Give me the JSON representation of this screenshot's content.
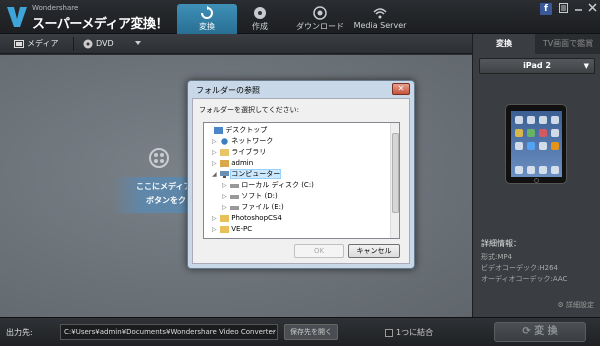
{
  "app": {
    "brand_small": "Wondershare",
    "brand_title": "スーパーメディア変換！",
    "accent_color": "#3a8fbb"
  },
  "nav": {
    "tabs": [
      {
        "label": "変換",
        "icon": "convert-icon",
        "active": true
      },
      {
        "label": "作成",
        "icon": "disc-icon",
        "active": false
      },
      {
        "label": "ダウンロード",
        "icon": "download-icon",
        "active": false
      },
      {
        "label": "Media Server",
        "icon": "wifi-icon",
        "active": false
      }
    ]
  },
  "window_controls": {
    "facebook": "f"
  },
  "toolbar": {
    "media_label": "メディア",
    "dvd_label": "DVD"
  },
  "main": {
    "drop_line1": "ここにメディア",
    "drop_line2": "ボタンをク"
  },
  "right_panel": {
    "tab_convert": "変換",
    "tab_tv": "TV画面で鑑賞",
    "device": "iPad 2",
    "details_title": "詳細情報：",
    "details": [
      "形式:MP4",
      "ビデオコーデック:H264",
      "オーディオコーデック:AAC"
    ],
    "advanced_label": "詳細設定"
  },
  "bottom": {
    "output_label": "出力先:",
    "output_path": "C:¥Users¥admin¥Documents¥Wondershare Video Converter Ultimate¥Or",
    "path_more": "···",
    "browse_label": "保存先を開く",
    "merge_label": "1つに結合",
    "convert_label": "変 換"
  },
  "dialog": {
    "title": "フォルダーの参照",
    "close": "✕",
    "instruction": "フォルダーを選択してください:",
    "tree": [
      {
        "label": "デスクトップ",
        "level": 0,
        "expander": "",
        "icon": "desktop-folder-icon",
        "selected": false
      },
      {
        "label": "ネットワーク",
        "level": 1,
        "expander": "▷",
        "icon": "network-icon",
        "selected": false
      },
      {
        "label": "ライブラリ",
        "level": 1,
        "expander": "▷",
        "icon": "library-icon",
        "selected": false
      },
      {
        "label": "admin",
        "level": 1,
        "expander": "▷",
        "icon": "user-folder-icon",
        "selected": false
      },
      {
        "label": "コンピューター",
        "level": 1,
        "expander": "◢",
        "icon": "computer-icon",
        "selected": true
      },
      {
        "label": "ローカル ディスク (C:)",
        "level": 2,
        "expander": "▷",
        "icon": "drive-icon",
        "selected": false
      },
      {
        "label": "ソフト (D:)",
        "level": 2,
        "expander": "▷",
        "icon": "drive-icon",
        "selected": false
      },
      {
        "label": "ファイル (E:)",
        "level": 2,
        "expander": "▷",
        "icon": "drive-icon",
        "selected": false
      },
      {
        "label": "PhotoshopCS4",
        "level": 1,
        "expander": "▷",
        "icon": "folder-icon",
        "selected": false
      },
      {
        "label": "VE-PC",
        "level": 1,
        "expander": "▷",
        "icon": "folder-icon",
        "selected": false
      }
    ],
    "ok_label": "OK",
    "cancel_label": "キャンセル"
  }
}
